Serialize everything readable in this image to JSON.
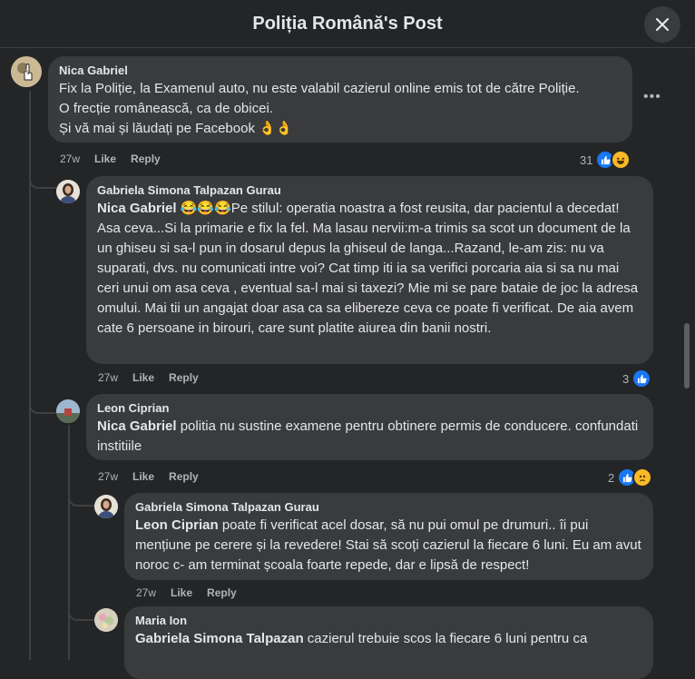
{
  "header": {
    "title": "Poliția Română's Post"
  },
  "comments": [
    {
      "author": "Nica Gabriel",
      "lines": [
        "Fix la Poliție, la Examenul auto, nu este valabil cazierul online emis tot de către Poliție.",
        "O frecție românească, ca de obicei.",
        "Și vă mai și lăudați pe Facebook 👌👌"
      ],
      "time": "27w",
      "like": "Like",
      "reply": "Reply",
      "reactions": "31"
    },
    {
      "author": "Gabriela Simona Talpazan Gurau",
      "mention": "Nica Gabriel",
      "emojis": "😂😂😂",
      "text": "Pe stilul: operatia noastra a fost reusita, dar pacientul a decedat! Asa ceva...Si la primarie e fix la fel. Ma lasau nervii:m-a trimis sa scot un document de la un ghiseu si sa-l pun in dosarul depus la ghiseul de langa...Razand, le-am zis: nu va suparati, dvs. nu comunicati intre voi? Cat timp iti ia sa verifici porcaria aia si sa nu mai ceri unui om asa ceva , eventual sa-l mai si taxezi? Mie mi se pare bataie de joc la adresa omului. Mai tii un angajat doar asa ca sa elibereze ceva ce poate fi verificat. De aia avem cate 6 persoane in birouri, care sunt platite aiurea din banii nostri.",
      "time": "27w",
      "like": "Like",
      "reply": "Reply",
      "reactions": "3"
    },
    {
      "author": "Leon Ciprian",
      "mention": "Nica Gabriel",
      "text": " politia nu sustine examene pentru obtinere permis de conducere. confundati institiile",
      "time": "27w",
      "like": "Like",
      "reply": "Reply",
      "reactions": "2"
    },
    {
      "author": "Gabriela Simona Talpazan Gurau",
      "mention": "Leon Ciprian",
      "text": " poate fi verificat acel dosar, să nu pui omul pe drumuri.. îi pui mențiune pe cerere și la revedere! Stai să scoți cazierul la fiecare 6 luni. Eu am avut noroc c- am terminat școala foarte repede, dar e lipsă de respect!",
      "time": "27w",
      "like": "Like",
      "reply": "Reply"
    },
    {
      "author": "Maria Ion",
      "mention": "Gabriela Simona Talpazan",
      "text": " cazierul trebuie scos la fiecare 6 luni pentru ca"
    }
  ],
  "icons": {
    "close": "close-icon",
    "like": "like-reaction-icon",
    "haha": "haha-reaction-icon",
    "sad": "sad-reaction-icon",
    "more": "more-options-icon"
  }
}
